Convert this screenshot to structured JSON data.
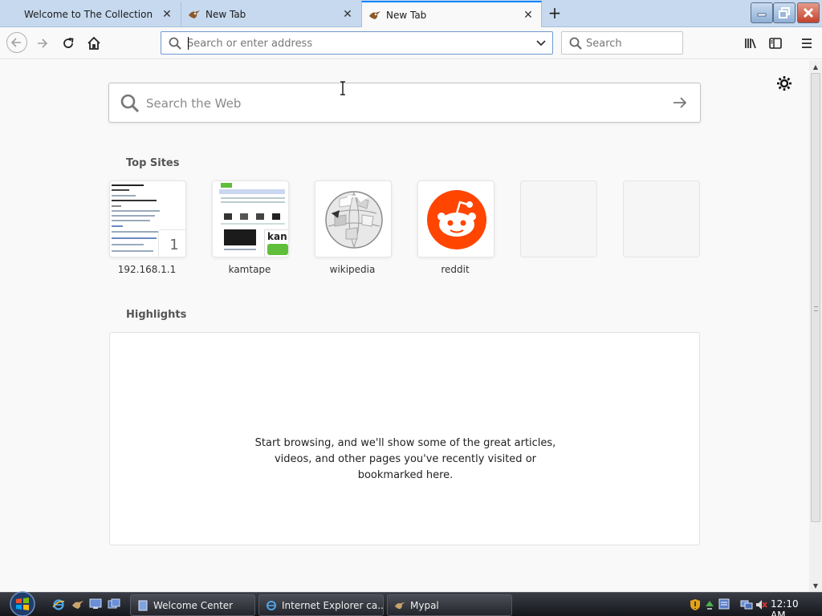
{
  "tabs": [
    {
      "title": "Welcome to The Collection Bo",
      "active": false
    },
    {
      "title": "New Tab",
      "active": false
    },
    {
      "title": "New Tab",
      "active": true
    }
  ],
  "toolbar": {
    "url_placeholder": "Search or enter address",
    "search_placeholder": "Search"
  },
  "newtab": {
    "web_search_placeholder": "Search the Web",
    "top_sites_title": "Top Sites",
    "top_sites": [
      {
        "label": "192.168.1.1",
        "pin_badge": "1"
      },
      {
        "label": "kamtape"
      },
      {
        "label": "wikipedia"
      },
      {
        "label": "reddit"
      },
      {
        "label": ""
      },
      {
        "label": ""
      }
    ],
    "highlights_title": "Highlights",
    "highlights_empty_line1": "Start browsing, and we'll show some of the great articles,",
    "highlights_empty_line2": "videos, and other pages you've recently visited or",
    "highlights_empty_line3": "bookmarked here."
  },
  "taskbar": {
    "buttons": [
      {
        "label": "Welcome Center",
        "icon": "welcome-center-icon"
      },
      {
        "label": "Internet Explorer ca...",
        "icon": "internet-explorer-icon"
      },
      {
        "label": "Mypal",
        "icon": "mypal-icon"
      }
    ],
    "clock": "12:10 AM"
  },
  "colors": {
    "tab_accent": "#0a84ff",
    "reddit_orange": "#ff4500",
    "kamtape_green": "#5fbf3a"
  }
}
